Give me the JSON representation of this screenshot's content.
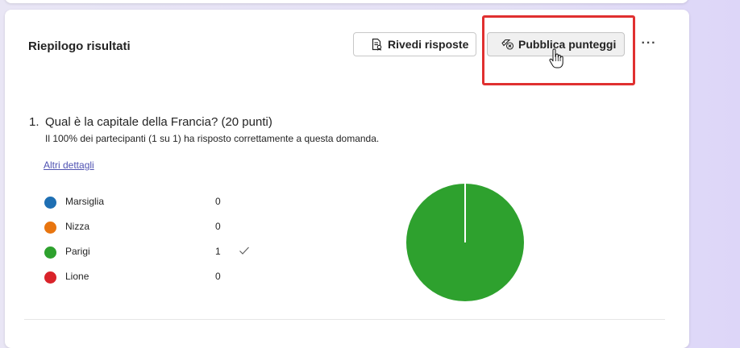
{
  "summary": {
    "title": "Riepilogo risultati",
    "review_label": "Rivedi risposte",
    "publish_label": "Pubblica punteggi",
    "more_label": "···"
  },
  "question": {
    "number": "1.",
    "text": "Qual è la capitale della Francia? (20 punti)",
    "subtitle": "Il 100% dei partecipanti (1 su 1) ha risposto correttamente a questa domanda.",
    "details_link": "Altri dettagli"
  },
  "chart_data": {
    "type": "pie",
    "categories": [
      "Marsiglia",
      "Nizza",
      "Parigi",
      "Lione"
    ],
    "values": [
      0,
      0,
      1,
      0
    ],
    "counts": [
      "0",
      "0",
      "1",
      "0"
    ],
    "colors": [
      "#1e6fb3",
      "#e8750f",
      "#2ea12e",
      "#d9232a"
    ],
    "correct_index": 2
  }
}
